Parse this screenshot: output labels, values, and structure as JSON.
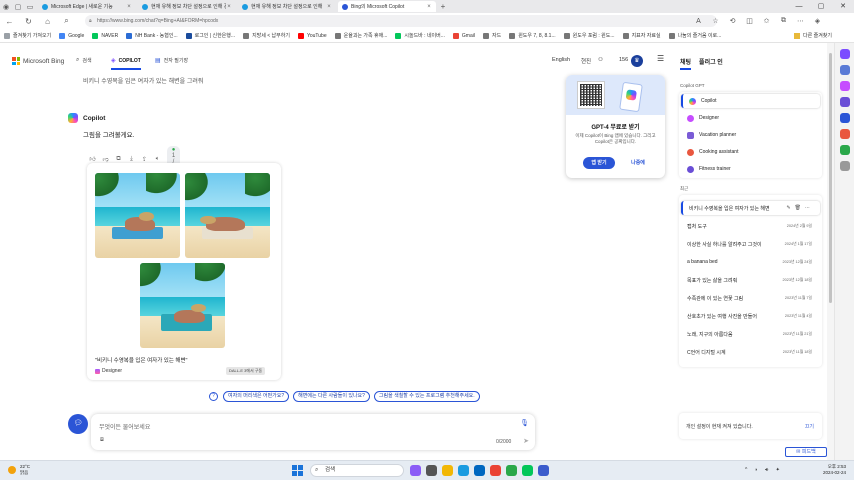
{
  "browser": {
    "tabs": [
      {
        "title": "Microsoft Edge | 새로운 기능",
        "active": false,
        "color": "#1a9be0"
      },
      {
        "title": "현재 유해 정보 차단 설정으로 인해 경",
        "active": false,
        "color": "#1a9be0"
      },
      {
        "title": "현재 유해 정보 차단 설정으로 인해",
        "active": false,
        "color": "#1a9be0"
      },
      {
        "title": "Bing의 Microsoft Copilot",
        "active": true,
        "color": "#2b55d6"
      }
    ],
    "url": "https://www.bing.com/chat?q=Bing+AI&FORM=hpcodx",
    "favorites": [
      "즐겨찾기 가져오기",
      "Google",
      "NAVER",
      "NH Bank - 농협인...",
      "로그인 | 신한은행...",
      "지방세 < 납부하기",
      "YouTube",
      "운율괴는 가족 휴애...",
      "시놀드바 : 네이버...",
      "Gmail",
      "자드",
      "윈도우 7, 8, 8.1...",
      "윈도우 포럼 : 윈도...",
      "지표자 자료실",
      "나눔의 즐거움 이로..."
    ],
    "other_favorites": "다른 즐겨찾기"
  },
  "bing": {
    "logo": "Microsoft Bing",
    "nav": {
      "search": "검색",
      "copilot": "COPILOT",
      "notebook": "전자 필기장"
    },
    "language": "English",
    "user": "현진",
    "points": "156"
  },
  "chat": {
    "prev_prompt": "비키니 수영복을 입은 여자가 있는 해변을 그려줘",
    "copilot_name": "Copilot",
    "response": "그림을 그려볼게요.",
    "counter": "1 / 30",
    "caption": "\"비키니 수영복을 입은 여자가 있는 해변\"",
    "designer_label": "Designer",
    "dalle_label": "DALL-E 3에서 구동",
    "suggestions": [
      "여자의 머리색은 어떤가요?",
      "해변에는 다른 사람들이 있나요?",
      "그림을 색칠할 수 있는 프로그램 추천해주세요."
    ],
    "input_placeholder": "무엇이든 물어보세요",
    "char_count": "0/2000"
  },
  "popup": {
    "title": "GPT-4 무료로 받기",
    "desc": "이제 Copilot이 Bing 앱에 있습니다. 그리고 Copilot은 공짜입니다.",
    "open_label": "앱 받기",
    "later_label": "나중에"
  },
  "right_panel": {
    "tabs": [
      "채팅",
      "플러그 인"
    ],
    "gpt_heading": "Copilot GPT",
    "gpts": [
      {
        "label": "Copilot",
        "color": "#7b4dff"
      },
      {
        "label": "Designer",
        "color": "#c64dff"
      },
      {
        "label": "Vacation planner",
        "color": "#7a5bd6"
      },
      {
        "label": "Cooking assistant",
        "color": "#e9573f"
      },
      {
        "label": "Fitness trainer",
        "color": "#6a4ed6"
      }
    ],
    "recent_heading": "최근",
    "recent": [
      {
        "title": "비키니 수영복을 입은 여자가 있는 해변",
        "date": ""
      },
      {
        "title": "캡처 도구",
        "date": "2024년 2월 9일"
      },
      {
        "title": "이상한 사실 하나를 알려주고 그것이",
        "date": "2024년 1월 17일"
      },
      {
        "title": "a banana bed",
        "date": "2023년 12월 24일"
      },
      {
        "title": "목표가 있는 삶을 그려줘",
        "date": "2023년 12월 18일"
      },
      {
        "title": "수족관에 이 있는 연꽃 그림",
        "date": "2023년 11월 7일"
      },
      {
        "title": "산호초가 있는 여행 사진을 만들어",
        "date": "2023년 11월 4일"
      },
      {
        "title": "노래, 지구의 아름다움",
        "date": "2023년 11월 21일"
      },
      {
        "title": "C언어 디지털 시계",
        "date": "2023년 11월 18일"
      }
    ],
    "privacy_text": "개인 설정이 현재 켜져 있습니다.",
    "privacy_off": "끄기",
    "feedback": "피드백"
  },
  "taskbar": {
    "temp": "22°C",
    "weather": "맑음",
    "search": "검색",
    "time": "오후 2:53",
    "date": "2024-02-24"
  }
}
